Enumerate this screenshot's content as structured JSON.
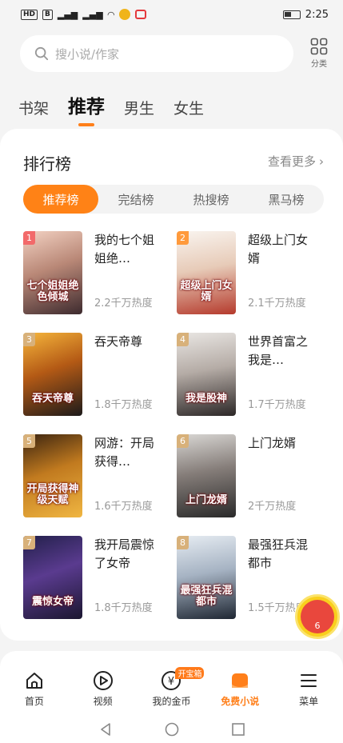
{
  "status": {
    "time": "2:25",
    "left_icons": [
      "HD",
      "B"
    ]
  },
  "search": {
    "placeholder": "搜小说/作家"
  },
  "category": {
    "label": "分类"
  },
  "tabs": [
    {
      "label": "书架"
    },
    {
      "label": "推荐"
    },
    {
      "label": "男生"
    },
    {
      "label": "女生"
    }
  ],
  "ranking": {
    "title": "排行榜",
    "more": "查看更多",
    "subtabs": [
      "推荐榜",
      "完结榜",
      "热搜榜",
      "黑马榜"
    ],
    "books": [
      {
        "rank": "1",
        "title": "我的七个姐姐绝…",
        "heat": "2.2千万热度",
        "cover_text": "七个姐姐绝色倾城"
      },
      {
        "rank": "2",
        "title": "超级上门女婿",
        "heat": "2.1千万热度",
        "cover_text": "超级上门女婿"
      },
      {
        "rank": "3",
        "title": "吞天帝尊",
        "heat": "1.8千万热度",
        "cover_text": "吞天帝尊"
      },
      {
        "rank": "4",
        "title": "世界首富之我是…",
        "heat": "1.7千万热度",
        "cover_text": "我是股神"
      },
      {
        "rank": "5",
        "title": "网游：开局获得…",
        "heat": "1.6千万热度",
        "cover_text": "开局获得神级天赋"
      },
      {
        "rank": "6",
        "title": "上门龙婿",
        "heat": "2千万热度",
        "cover_text": "上门龙婿"
      },
      {
        "rank": "7",
        "title": "我开局震惊了女帝",
        "heat": "1.8千万热度",
        "cover_text": "震惊女帝"
      },
      {
        "rank": "8",
        "title": "最强狂兵混都市",
        "heat": "1.5千万热度",
        "cover_text": "最强狂兵混都市"
      }
    ]
  },
  "float_badge": {
    "count": "6"
  },
  "bottom_nav": [
    {
      "label": "首页",
      "badge": ""
    },
    {
      "label": "视频",
      "badge": ""
    },
    {
      "label": "我的金币",
      "badge": "开宝箱"
    },
    {
      "label": "免费小说",
      "badge": ""
    },
    {
      "label": "菜单",
      "badge": ""
    }
  ],
  "colors": {
    "accent": "#ff8216",
    "rank_top": "#f26a6a",
    "rank_second": "#ff9a3c",
    "rank_other": "#d8b17a"
  }
}
